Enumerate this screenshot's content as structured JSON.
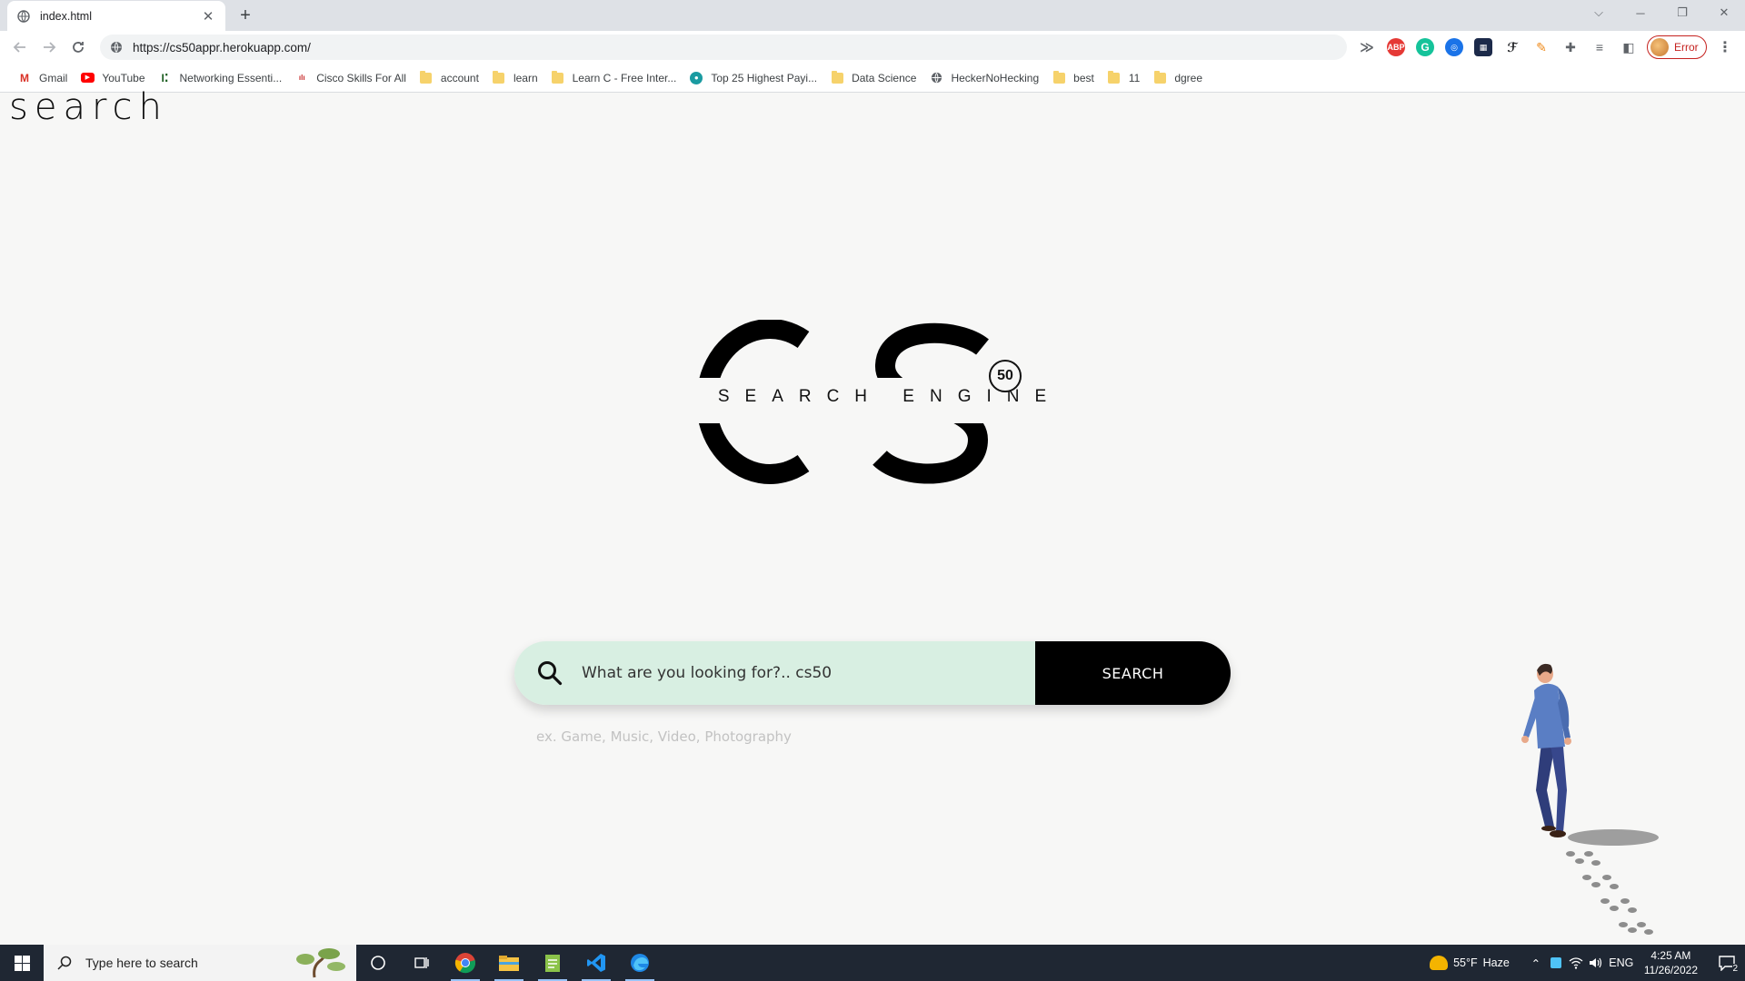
{
  "browser": {
    "tab": {
      "title": "index.html"
    },
    "url": "https://cs50appr.herokuapp.com/",
    "profile_label": "Error",
    "bookmarks": [
      {
        "label": "Gmail",
        "icon": "gmail-icon"
      },
      {
        "label": "YouTube",
        "icon": "youtube-icon"
      },
      {
        "label": "Networking Essenti...",
        "icon": "networking-icon"
      },
      {
        "label": "Cisco Skills For All",
        "icon": "cisco-icon"
      },
      {
        "label": "account",
        "icon": "folder-icon"
      },
      {
        "label": "learn",
        "icon": "folder-icon"
      },
      {
        "label": "Learn C - Free Inter...",
        "icon": "folder-icon"
      },
      {
        "label": "Top 25 Highest Payi...",
        "icon": "drop-icon"
      },
      {
        "label": "Data Science",
        "icon": "folder-icon"
      },
      {
        "label": "HeckerNoHecking",
        "icon": "globe-icon"
      },
      {
        "label": "best",
        "icon": "folder-icon"
      },
      {
        "label": "11",
        "icon": "folder-icon"
      },
      {
        "label": "dgree",
        "icon": "folder-icon"
      }
    ]
  },
  "page": {
    "corner_word": "search",
    "logo": {
      "letters": "CS",
      "subtitle": "SEARCH ENGINE",
      "badge": "50"
    },
    "search": {
      "value": "What are you looking for?.. cs50",
      "button_label": "SEARCH",
      "hint": "ex. Game, Music, Video, Photography"
    }
  },
  "taskbar": {
    "search_placeholder": "Type here to search",
    "weather": {
      "temp": "55°F",
      "condition": "Haze"
    },
    "language": "ENG",
    "time": "4:25 AM",
    "date": "11/26/2022",
    "notification_count": "2"
  },
  "colors": {
    "search_field_bg": "#d8efe2",
    "search_button_bg": "#000000",
    "page_bg": "#f7f7f6",
    "taskbar_bg": "#1f2733"
  }
}
